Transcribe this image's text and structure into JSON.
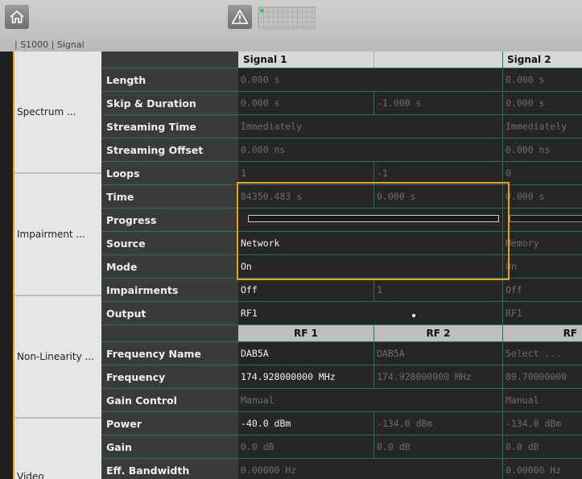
{
  "breadcrumb": "| S1000 | Signal",
  "icons": {
    "home": "home-icon",
    "warning": "warning-icon"
  },
  "colors": {
    "accent": "#e8a317",
    "grid_line": "#2f6b63",
    "status_indicator": "#2ecc40"
  },
  "nav": [
    {
      "label": "Spectrum ..."
    },
    {
      "label": "Impairment ..."
    },
    {
      "label": "Non-Linearity ..."
    },
    {
      "label": "Video"
    }
  ],
  "table": {
    "headers": {
      "signal1": "Signal 1",
      "signal2": "Signal 2"
    },
    "rf_headers": {
      "rf1": "RF 1",
      "rf2": "RF 2",
      "rf3": "RF"
    },
    "rows": {
      "length": {
        "label": "Length",
        "c12": "0.000 s",
        "c3": "0.000 s"
      },
      "skip_duration": {
        "label": "Skip & Duration",
        "c1": "0.000 s",
        "c2": "-1.000 s",
        "c3": "0.000 s"
      },
      "streaming_time": {
        "label": "Streaming Time",
        "c12": "Immediately",
        "c3": "Immediately"
      },
      "streaming_offset": {
        "label": "Streaming Offset",
        "c12": "0.000 ns",
        "c3": "0.000 ns"
      },
      "loops": {
        "label": "Loops",
        "c1": "1",
        "c2": "-1",
        "c3": "0"
      },
      "time": {
        "label": "Time",
        "c1": "84350.483 s",
        "c2": "0.000 s",
        "c3": "0.000 s"
      },
      "progress": {
        "label": "Progress",
        "value": 0
      },
      "source": {
        "label": "Source",
        "c12": "Network",
        "c3": "Memory"
      },
      "mode": {
        "label": "Mode",
        "c12": "On",
        "c3": "On"
      },
      "impairments": {
        "label": "Impairments",
        "c1": "Off",
        "c2": "1",
        "c3": "Off"
      },
      "output": {
        "label": "Output",
        "c12": "RF1",
        "c3": "RF1"
      },
      "frequency_name": {
        "label": "Frequency Name",
        "c1": "DAB5A",
        "c2": "DAB5A",
        "c3": "Select ..."
      },
      "frequency": {
        "label": "Frequency",
        "c1": "174.928000000 MHz",
        "c2": "174.928000000 MHz",
        "c3": "89.70000000"
      },
      "gain_control": {
        "label": "Gain Control",
        "c12": "Manual",
        "c3": "Manual"
      },
      "power": {
        "label": "Power",
        "c1": "-40.0 dBm",
        "c2": "-134.0 dBm",
        "c3": "-134.0 dBm"
      },
      "gain": {
        "label": "Gain",
        "c1": "0.0 dB",
        "c2": "0.0 dB",
        "c3": "0.0 dB"
      },
      "eff_bandwidth": {
        "label": "Eff. Bandwidth",
        "c12": "0.00000 Hz",
        "c3": "0.00000 Hz"
      }
    }
  }
}
